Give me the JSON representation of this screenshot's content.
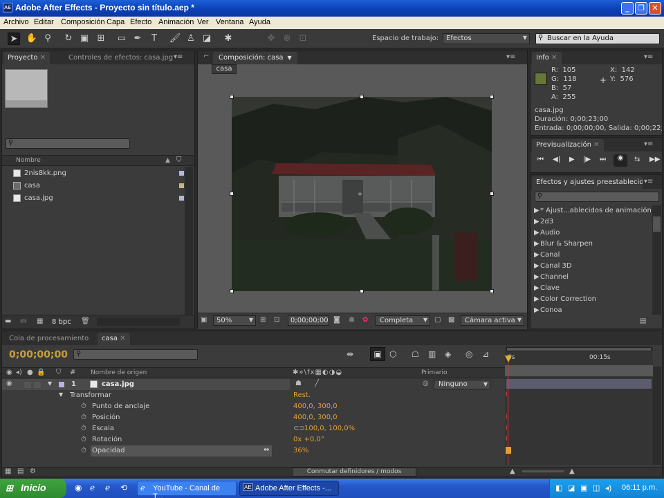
{
  "window": {
    "app_logo": "AE",
    "title": "Adobe After Effects - Proyecto sin título.aep *",
    "controls": [
      "_",
      "❐",
      "✕"
    ]
  },
  "menu": [
    "Archivo",
    "Editar",
    "Composición",
    "Capa",
    "Efecto",
    "Animación",
    "Ver",
    "Ventana",
    "Ayuda"
  ],
  "toolbar": {
    "workspace_label": "Espacio de trabajo:",
    "workspace_value": "Efectos",
    "help_search_placeholder": "Buscar en la Ayuda"
  },
  "project_panel": {
    "tabs": [
      "Proyecto",
      "Controles de efectos: casa.jpg"
    ],
    "col_name": "Nombre",
    "items": [
      {
        "name": "2nis8kk.png",
        "type": "image",
        "label_color": "#b4b4e6"
      },
      {
        "name": "casa",
        "type": "composition",
        "label_color": "#c8b482"
      },
      {
        "name": "casa.jpg",
        "type": "image",
        "label_color": "#b4b4e6"
      }
    ],
    "bpc": "8 bpc"
  },
  "composition_panel": {
    "tab": "Composición: casa",
    "comp_button": "casa",
    "zoom": "50%",
    "timecode": "0;00;00;00",
    "resolution": "Completa",
    "camera": "Cámara activa"
  },
  "info_panel": {
    "tab": "Info",
    "r_label": "R:",
    "r": "105",
    "g_label": "G:",
    "g": "118",
    "b_label": "B:",
    "b": "57",
    "a_label": "A:",
    "a": "255",
    "x_label": "X:",
    "x": "142",
    "y_label": "Y:",
    "y": "576",
    "sample_color": "#697639",
    "file": "casa.jpg",
    "duration": "Duración: 0;00;23;00",
    "in_out": "Entrada: 0;00;00;00, Salida: 0;00;22;29"
  },
  "preview_panel": {
    "tab": "Previsualización"
  },
  "effects_panel": {
    "tab": "Efectos y ajustes preestablecidos",
    "items": [
      "* Ajust...ablecidos de animación",
      "2d3",
      "Audio",
      "Blur & Sharpen",
      "Canal",
      "Canal 3D",
      "Channel",
      "Clave",
      "Color Correction",
      "Conoa"
    ]
  },
  "bottom_tabs": [
    "Cola de procesamiento",
    "casa"
  ],
  "timeline": {
    "timecode": "0;00;00;00",
    "col_source": "Nombre de origen",
    "col_parent": "Primario",
    "ruler_start": "0s",
    "ruler_mid": "00:15s",
    "layer": {
      "index": "1",
      "name": "casa.jpg",
      "parent": "Ninguno"
    },
    "transform_label": "Transformar",
    "transform_reset": "Rest.",
    "properties": [
      {
        "name": "Punto de anclaje",
        "value": "400,0, 300,0"
      },
      {
        "name": "Posición",
        "value": "400,0, 300,0"
      },
      {
        "name": "Escala",
        "value": "100,0, 100,0%"
      },
      {
        "name": "Rotación",
        "value": "0x +0,0°"
      },
      {
        "name": "Opacidad",
        "value": "36%"
      }
    ],
    "toggle_button": "Conmutar definidores / modos"
  },
  "taskbar": {
    "start": "Inicio",
    "items": [
      "YouTube - Canal de T...",
      "Adobe After Effects -..."
    ],
    "clock": "06:11 p.m."
  }
}
